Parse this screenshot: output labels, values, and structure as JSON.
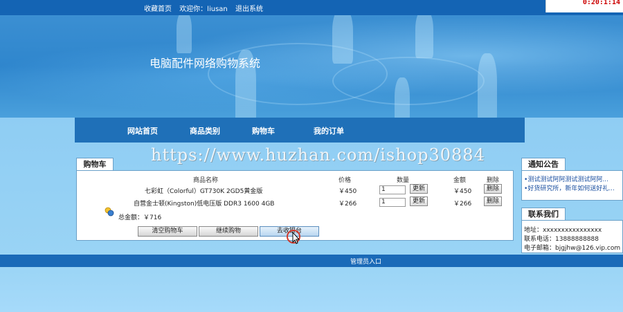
{
  "topbar": {
    "links": [
      "收藏首页",
      "欢迎你：liusan",
      "退出系统"
    ],
    "clock": "0:20:1:14"
  },
  "banner": {
    "title": "电脑配件网络购物系统"
  },
  "nav": {
    "items": [
      "网站首页",
      "商品类别",
      "购物车",
      "我的订单"
    ]
  },
  "watermark": "https://www.huzhan.com/ishop30884",
  "cart": {
    "tab_label": "购物车",
    "columns": [
      "商品名称",
      "价格",
      "数量",
      "金额",
      "删除"
    ],
    "rows": [
      {
        "name": "七彩虹（Colorful）GT730K 2GD5黄金版",
        "price": "￥450",
        "qty": "1",
        "update": "更新",
        "amount": "￥450",
        "delete": "删除"
      },
      {
        "name": "自营金士顿(Kingston)低电压版 DDR3 1600 4GB",
        "price": "￥266",
        "qty": "1",
        "update": "更新",
        "amount": "￥266",
        "delete": "删除"
      }
    ],
    "total": "总金额：￥716",
    "buttons": {
      "clear": "清空购物车",
      "continue": "继续购物",
      "checkout": "去收银台"
    }
  },
  "notice": {
    "title": "通知公告",
    "items": [
      "测试测试阿阿测试测试阿阿...",
      "好货研究所，新年如何送好礼..."
    ]
  },
  "contact": {
    "title": "联系我们",
    "address": "地址：xxxxxxxxxxxxxxxx",
    "phone": "联系电话：13888888888",
    "email": "电子邮箱：bjgjhw@126.vip.com"
  },
  "footer": {
    "admin_link": "管理员入口"
  },
  "colors": {
    "topbar": "#1464b4",
    "nav": "#1f70b8",
    "footer": "#1a6ab8",
    "link": "#1a4fa0"
  }
}
